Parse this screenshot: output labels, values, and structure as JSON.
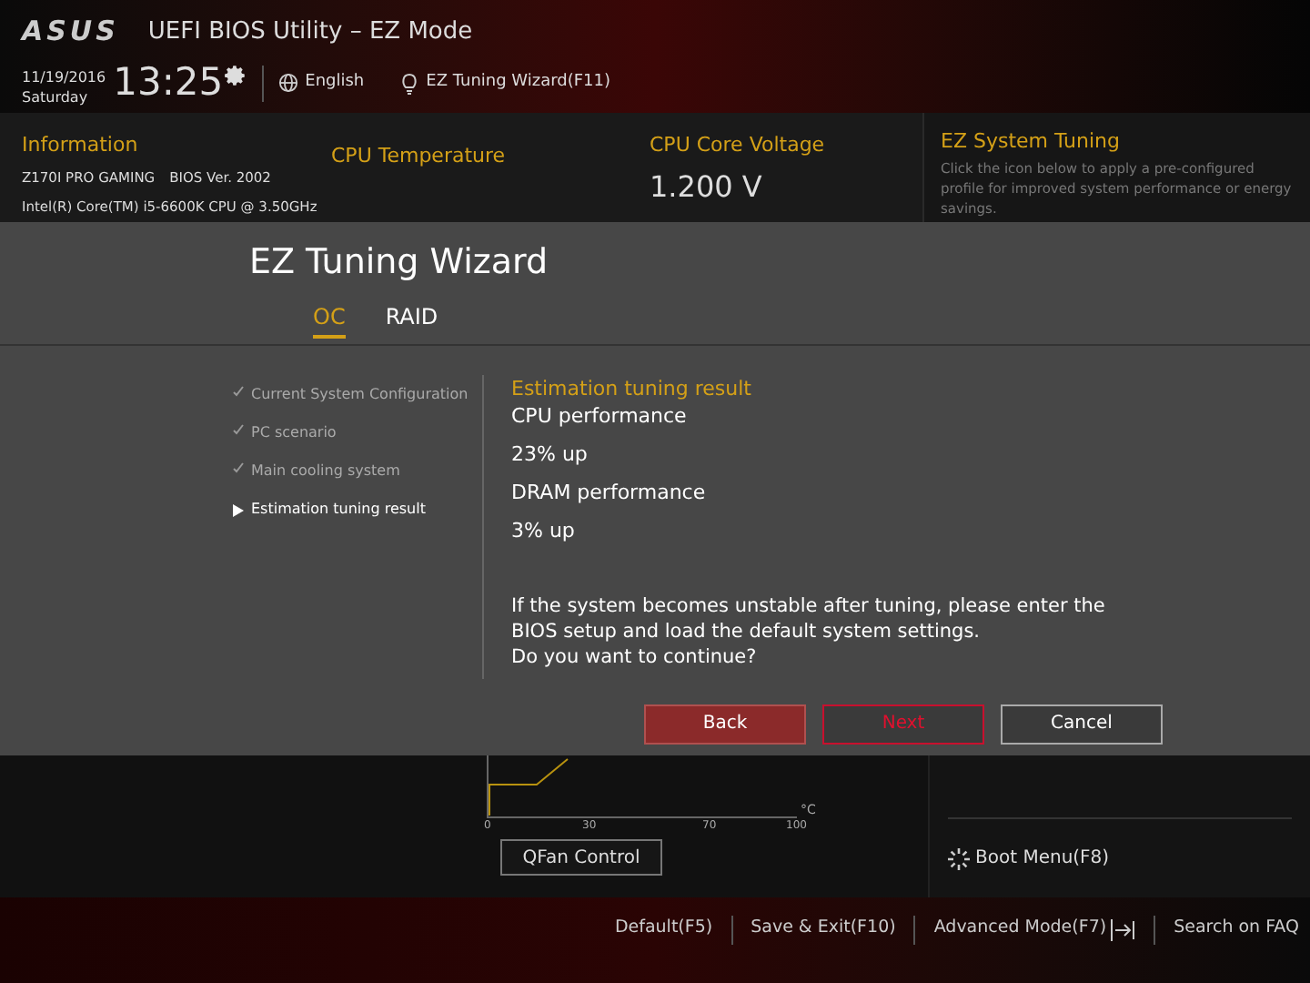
{
  "header": {
    "brand": "ASUS",
    "title": "UEFI BIOS Utility – EZ Mode",
    "date": "11/19/2016",
    "day": "Saturday",
    "time": "13:25",
    "language": "English",
    "wizard_link": "EZ Tuning Wizard(F11)"
  },
  "info": {
    "title": "Information",
    "board": "Z170I PRO GAMING",
    "bios": "BIOS Ver. 2002",
    "cpu": "Intel(R) Core(TM) i5-6600K CPU @ 3.50GHz"
  },
  "cpu_temperature": {
    "title": "CPU Temperature"
  },
  "cpu_voltage": {
    "title": "CPU Core Voltage",
    "value": "1.200 V"
  },
  "ez_system_tuning": {
    "title": "EZ System Tuning",
    "description": "Click the icon below to apply a pre-configured profile for improved system performance or energy savings."
  },
  "dialog": {
    "title": "EZ Tuning Wizard",
    "tabs": [
      {
        "label": "OC",
        "selected": true
      },
      {
        "label": "RAID",
        "selected": false
      }
    ],
    "steps": [
      {
        "label": "Current System Configuration",
        "kind": "done"
      },
      {
        "label": "PC scenario",
        "kind": "done"
      },
      {
        "label": "Main cooling system",
        "kind": "done"
      },
      {
        "label": "Estimation tuning result",
        "kind": "current"
      }
    ],
    "result_heading": "Estimation tuning result",
    "results": [
      "CPU performance",
      "23% up",
      "DRAM performance",
      "3% up"
    ],
    "warning": [
      "If the system becomes unstable after tuning, please enter the",
      "BIOS setup and load the default system settings.",
      "Do you want to continue?"
    ],
    "buttons": [
      {
        "label": "Back",
        "kind": "filled"
      },
      {
        "label": "Next",
        "kind": "focused"
      },
      {
        "label": "Cancel",
        "kind": "plain"
      }
    ]
  },
  "fan_chart": {
    "x_ticks": [
      "0",
      "30",
      "70",
      "100"
    ],
    "unit": "°C",
    "button": "QFan Control"
  },
  "boot_menu": "Boot Menu(F8)",
  "footer": [
    {
      "label": "Default(F5)",
      "kind": "text"
    },
    {
      "label": "Save & Exit(F10)",
      "kind": "text"
    },
    {
      "label": "Advanced Mode(F7)",
      "kind": "exit"
    },
    {
      "label": "Search on FAQ",
      "kind": "text"
    }
  ]
}
